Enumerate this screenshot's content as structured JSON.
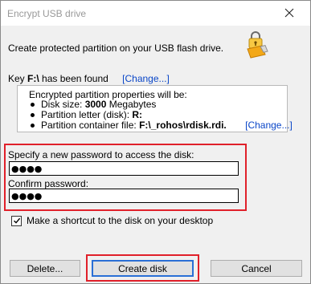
{
  "window": {
    "title": "Encrypt USB drive"
  },
  "subtitle": "Create protected partition on your USB flash drive.",
  "key": {
    "prefix": "Key",
    "drive": "F:\\",
    "suffix": "has been found",
    "change_link": "[Change...]"
  },
  "properties": {
    "heading": "Encrypted partition properties will be:",
    "disk_size_label": "Disk size:",
    "disk_size_value": "3000",
    "disk_size_unit": "Megabytes",
    "partition_letter_label": "Partition letter (disk):",
    "partition_letter_value": "R:",
    "container_label": "Partition container file:",
    "container_value": "F:\\_rohos\\rdisk.rdi.",
    "change_link": "[Change...]"
  },
  "password": {
    "label": "Specify a new password to access the disk:",
    "value": "●●●●",
    "confirm_label": "Confirm password:",
    "confirm_value": "●●●●"
  },
  "shortcut": {
    "label": "Make a shortcut to the disk on your desktop",
    "checked": true
  },
  "buttons": {
    "delete": "Delete...",
    "create": "Create disk",
    "cancel": "Cancel"
  },
  "icons": {
    "close": "close-icon",
    "usb": "usb-key-icon",
    "check": "checkmark-icon"
  },
  "colors": {
    "highlight": "#e0202a",
    "link": "#0a46c8",
    "usb_body": "#f3a817",
    "lock": "#f7c843"
  }
}
